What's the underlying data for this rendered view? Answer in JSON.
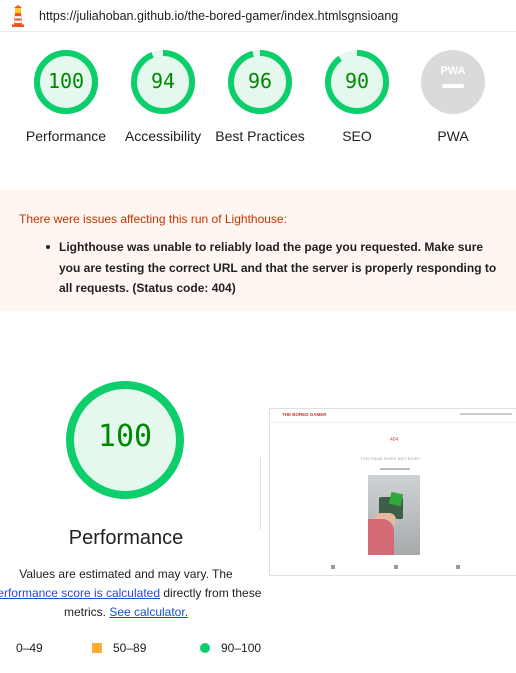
{
  "header": {
    "url": "https://juliahoban.github.io/the-bored-gamer/index.htmlsgnsioang",
    "logo_icon": "lighthouse-icon"
  },
  "colors": {
    "pass": "#0cce6b",
    "pass_text": "#008800",
    "pass_bg": "#e5f8ee",
    "average": "#ffaa33",
    "fail": "#cc0000",
    "warning_text": "#c33300",
    "warning_bg": "#fff6f1",
    "pwa_gray": "#dadada"
  },
  "gauges": [
    {
      "score": "100",
      "value": 100,
      "label": "Performance"
    },
    {
      "score": "94",
      "value": 94,
      "label": "Accessibility"
    },
    {
      "score": "96",
      "value": 96,
      "label": "Best Practices"
    },
    {
      "score": "90",
      "value": 90,
      "label": "SEO"
    },
    {
      "score": "",
      "badge": "PWA",
      "label": "PWA",
      "icon": "pwa-icon"
    }
  ],
  "warning": {
    "title": "There were issues affecting this run of Lighthouse:",
    "items": [
      "Lighthouse was unable to reliably load the page you requested. Make sure you are testing the correct URL and that the server is properly responding to all requests. (Status code: 404)"
    ]
  },
  "performance": {
    "score": "100",
    "value": 100,
    "title": "Performance",
    "desc_1": "Values are estimated and may vary. The ",
    "desc_link_1": "performance score is calculated",
    "desc_2": " directly from these metrics. ",
    "desc_link_2": "See calculator."
  },
  "screenshot": {
    "brand": "THE BORED GAMER",
    "error_code": "404",
    "page_title": "THIS PAGE DOES NOT EXIST"
  },
  "legend": [
    {
      "range": "0–49",
      "icon": "fail-triangle-icon"
    },
    {
      "range": "50–89",
      "icon": "average-square-icon"
    },
    {
      "range": "90–100",
      "icon": "pass-circle-icon"
    }
  ]
}
